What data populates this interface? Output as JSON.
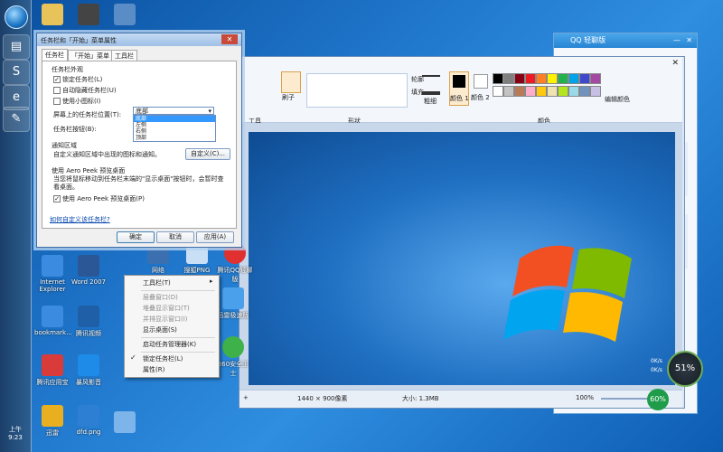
{
  "dialog": {
    "title": "任务栏和「开始」菜单属性",
    "tabs": [
      "任务栏",
      "「开始」菜单",
      "工具栏"
    ],
    "appearance_group": "任务栏外观",
    "lock_taskbar": "锁定任务栏(L)",
    "auto_hide": "自动隐藏任务栏(U)",
    "small_icons": "使用小图标(I)",
    "position_label": "屏幕上的任务栏位置(T):",
    "position_value": "底部",
    "position_options": [
      "底部",
      "左侧",
      "右侧",
      "顶部"
    ],
    "buttons_label": "任务栏按钮(B):",
    "notify_group": "通知区域",
    "notify_text": "自定义通知区域中出现的图标和通知。",
    "customize_button": "自定义(C)...",
    "peek_group": "使用 Aero Peek 预览桌面",
    "peek_text": "当您将鼠标移动到任务栏末端的\"显示桌面\"按钮时，会暂时查看桌面。",
    "peek_checkbox": "使用 Aero Peek 预览桌面(P)",
    "help_link": "如何自定义该任务栏?",
    "ok": "确定",
    "cancel": "取消",
    "apply": "应用(A)"
  },
  "context_menu": {
    "items": [
      "工具栏(T)",
      "层叠窗口(D)",
      "堆叠显示窗口(T)",
      "并排显示窗口(I)",
      "显示桌面(S)",
      "启动任务管理器(K)",
      "锁定任务栏(L)",
      "属性(R)"
    ]
  },
  "paint": {
    "tools_group": "工具",
    "brush": "刷子",
    "shapes_group": "形状",
    "outline": "轮廓",
    "fill": "填充",
    "size": "粗细",
    "color1": "颜色 1",
    "color2": "颜色 2",
    "edit_colors": "编辑颜色",
    "colors_group": "颜色",
    "status_size": "1440 × 900像素",
    "status_file": "大小: 1.3MB",
    "zoom": "100%",
    "palette": [
      "#000000",
      "#7f7f7f",
      "#880015",
      "#ed1c24",
      "#ff7f27",
      "#fff200",
      "#22b14c",
      "#00a2e8",
      "#3f48cc",
      "#a349a4",
      "#ffffff",
      "#c3c3c3",
      "#b97a57",
      "#ffaec9",
      "#ffc90e",
      "#efe4b0",
      "#b5e61d",
      "#99d9ea",
      "#7092be",
      "#c8bfe7"
    ]
  },
  "desktop_icons": [
    "Internet Explorer",
    "Word 2007",
    "bookmark...",
    "腾讯视频",
    "腾讯应用宝",
    "暴风影音",
    "迅雷",
    "dfd.png",
    "网络",
    "搜狐PNG",
    "腾讯QQ轻聊版",
    "迅雷极速版",
    "360安全卫士",
    "回收站"
  ],
  "qq": {
    "title": "QQ 轻聊版"
  },
  "gauges": {
    "cpu": "51%",
    "mem": "60%",
    "up": "0K/s",
    "down": "0K/s"
  },
  "clock": "上午 9:23"
}
